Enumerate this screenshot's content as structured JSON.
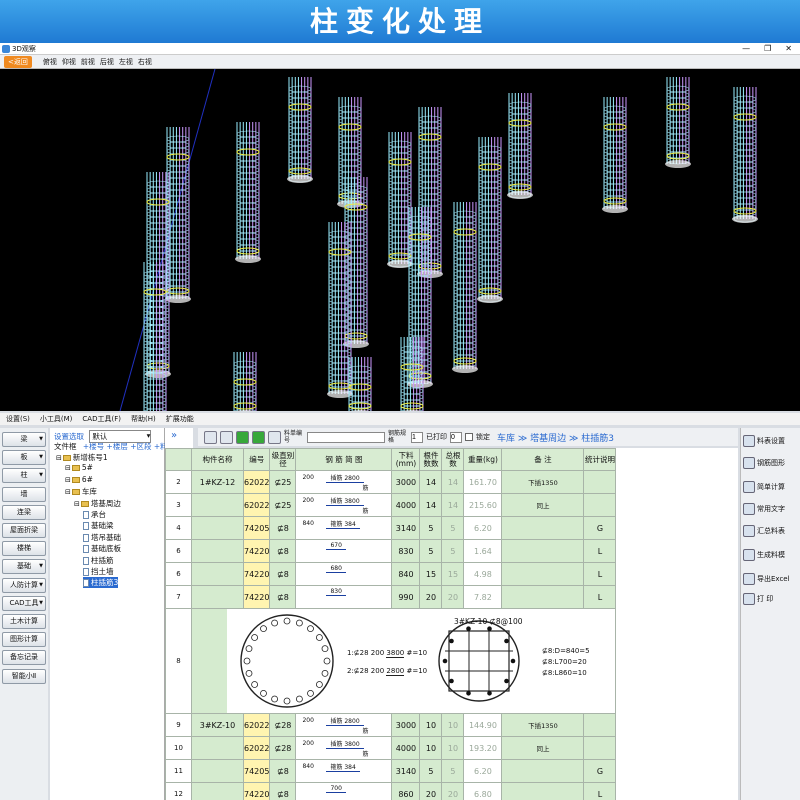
{
  "banner": {
    "title": "柱变化处理"
  },
  "window": {
    "title": "3D观察",
    "controls": [
      "—",
      "❐",
      "✕"
    ]
  },
  "toolbar3d": {
    "back": "<返回",
    "views": [
      "俯视",
      "仰视",
      "前视",
      "后视",
      "左视",
      "右视"
    ]
  },
  "menubar": [
    "设置(S)",
    "小工具(M)",
    "CAD工具(F)",
    "帮助(H)",
    "扩展功能"
  ],
  "left_buttons": [
    {
      "label": "梁",
      "arrow": true
    },
    {
      "label": "板",
      "arrow": true
    },
    {
      "label": "柱",
      "arrow": true
    },
    {
      "label": "墙",
      "arrow": false
    },
    {
      "label": "连梁",
      "arrow": false
    },
    {
      "label": "屋面折梁",
      "arrow": false
    },
    {
      "label": "楼梯",
      "arrow": false
    },
    {
      "label": "基础",
      "arrow": true
    },
    {
      "label": "人防计算",
      "arrow": true
    },
    {
      "label": "CAD工具",
      "arrow": true
    },
    {
      "label": "土木计算",
      "arrow": false
    },
    {
      "label": "图形计算",
      "arrow": false
    },
    {
      "label": "备忘记录",
      "arrow": false
    },
    {
      "label": "智能小Ⅱ",
      "arrow": false
    }
  ],
  "tree": {
    "settings_label": "设置选取",
    "settings_value": "默认",
    "filter_label": "文件框",
    "filter_opts": "+楼号 +楼层 +区段 +料表",
    "items": [
      {
        "label": "新增栋号1",
        "level": 0,
        "doc": false
      },
      {
        "label": "5#",
        "level": 1,
        "doc": false
      },
      {
        "label": "6#",
        "level": 1,
        "doc": false
      },
      {
        "label": "车库",
        "level": 1,
        "doc": false
      },
      {
        "label": "塔基周边",
        "level": 2,
        "doc": false
      },
      {
        "label": "承台",
        "level": 3,
        "doc": true
      },
      {
        "label": "基础梁",
        "level": 3,
        "doc": true
      },
      {
        "label": "塔吊基础",
        "level": 3,
        "doc": true
      },
      {
        "label": "基础底板",
        "level": 3,
        "doc": true
      },
      {
        "label": "柱插筋",
        "level": 3,
        "doc": true
      },
      {
        "label": "挡土墙",
        "level": 3,
        "doc": true
      },
      {
        "label": "柱插筋3",
        "level": 3,
        "doc": true,
        "selected": true
      }
    ]
  },
  "rtoolbar": {
    "arrows": "»",
    "label1": "料单编号",
    "label2": "钢筋规格",
    "input2": "1",
    "label3": "已打印",
    "input3": "0",
    "lock": "锁定",
    "breadcrumb": "车库 ≫ 塔基周边 ≫ 柱插筋3"
  },
  "table": {
    "headers": [
      "",
      "构件名称",
      "编号",
      "级直别径",
      "钢 筋 简 图",
      "下料(mm)",
      "根件数数",
      "总根数",
      "重量(kg)",
      "备 注",
      "统计说明"
    ],
    "rows": [
      {
        "idx": "2",
        "name": "1#KZ-12",
        "code": "62022",
        "spec": "⊈25",
        "shape": {
          "a": "200",
          "b": "插筋 2800",
          "c": "筋"
        },
        "len": "3000",
        "n1": "14",
        "n2": "14",
        "wt": "161.70",
        "note": "下插1350",
        "stat": ""
      },
      {
        "idx": "3",
        "name": "",
        "code": "62022",
        "spec": "⊈25",
        "shape": {
          "a": "200",
          "b": "插筋 3800",
          "c": "筋"
        },
        "len": "4000",
        "n1": "14",
        "n2": "14",
        "wt": "215.60",
        "note": "同上",
        "stat": ""
      },
      {
        "idx": "4",
        "name": "",
        "code": "74205",
        "spec": "⊈8",
        "shape": {
          "a": "840",
          "b": "箍筋 384",
          "c": ""
        },
        "len": "3140",
        "n1": "5",
        "n2": "5",
        "wt": "6.20",
        "note": "",
        "stat": "G"
      },
      {
        "idx": "6",
        "name": "",
        "code": "74220",
        "spec": "⊈8",
        "shape": {
          "a": "",
          "b": "670",
          "c": ""
        },
        "len": "830",
        "n1": "5",
        "n2": "5",
        "wt": "1.64",
        "note": "",
        "stat": "L"
      },
      {
        "idx": "6",
        "name": "",
        "code": "74220",
        "spec": "⊈8",
        "shape": {
          "a": "",
          "b": "680",
          "c": ""
        },
        "len": "840",
        "n1": "15",
        "n2": "15",
        "wt": "4.98",
        "note": "",
        "stat": "L"
      },
      {
        "idx": "7",
        "name": "",
        "code": "74220",
        "spec": "⊈8",
        "shape": {
          "a": "",
          "b": "830",
          "c": ""
        },
        "len": "990",
        "n1": "20",
        "n2": "20",
        "wt": "7.82",
        "note": "",
        "stat": "L"
      }
    ],
    "drawing_row": {
      "idx": "8",
      "label1": "1:⊈28 200",
      "label1b": "3800",
      "label1c": "#=10",
      "label2": "2:⊈28 200",
      "label2b": "2800",
      "label2c": "#=10",
      "section_title": "3#KZ-10 ⊈8@100",
      "legend": [
        "⊈8:D=840=5",
        "⊈8:L700=20",
        "⊈8:L860=10"
      ]
    },
    "rows2": [
      {
        "idx": "9",
        "name": "3#KZ-10",
        "code": "62022",
        "spec": "⊈28",
        "shape": {
          "a": "200",
          "b": "插筋 2800",
          "c": "筋"
        },
        "len": "3000",
        "n1": "10",
        "n2": "10",
        "wt": "144.90",
        "note": "下插1350",
        "stat": ""
      },
      {
        "idx": "10",
        "name": "",
        "code": "62022",
        "spec": "⊈28",
        "shape": {
          "a": "200",
          "b": "插筋 3800",
          "c": "筋"
        },
        "len": "4000",
        "n1": "10",
        "n2": "10",
        "wt": "193.20",
        "note": "同上",
        "stat": ""
      },
      {
        "idx": "11",
        "name": "",
        "code": "74205",
        "spec": "⊈8",
        "shape": {
          "a": "840",
          "b": "箍筋 384",
          "c": ""
        },
        "len": "3140",
        "n1": "5",
        "n2": "5",
        "wt": "6.20",
        "note": "",
        "stat": "G"
      },
      {
        "idx": "12",
        "name": "",
        "code": "74220",
        "spec": "⊈8",
        "shape": {
          "a": "",
          "b": "700",
          "c": ""
        },
        "len": "860",
        "n1": "20",
        "n2": "20",
        "wt": "6.80",
        "note": "",
        "stat": "L"
      }
    ]
  },
  "right_buttons": [
    "料表设置",
    "钢筋图形",
    "简单计算",
    "常用文字",
    "汇总料表",
    "生成料模",
    "导出Excel",
    "打 印"
  ],
  "colors": {
    "banner": "#1f7ad3",
    "grid_green": "#d5ebcf",
    "code_yellow": "#fff4b0"
  }
}
